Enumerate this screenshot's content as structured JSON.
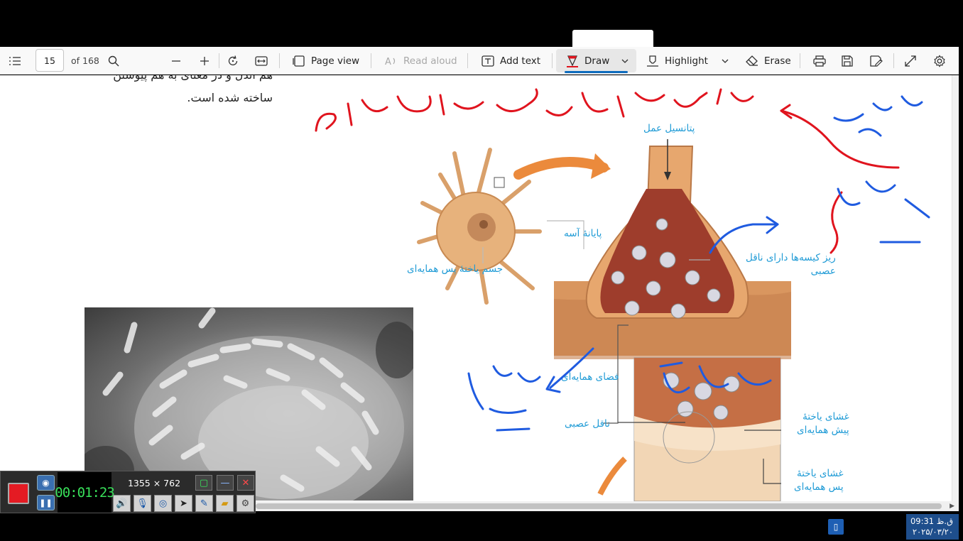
{
  "toolbar": {
    "page_current": "15",
    "page_total": "of 168",
    "page_view": "Page view",
    "read_aloud": "Read aloud",
    "add_text": "Add text",
    "draw": "Draw",
    "highlight": "Highlight",
    "erase": "Erase"
  },
  "document": {
    "text_line1": "هم اندل و در معنای به هم پیوستن",
    "text_line2": "ساخته شده است.",
    "labels": {
      "action_potential": "پتانسیل عمل",
      "terminal_bulb": "پایانهٔ آسه",
      "postsynaptic_body": "جسم یاختهٔ پس همایه‌ای",
      "vesicles_line1": "ریز کیسه‌ها دارای ناقل",
      "vesicles_line2": "عصبی",
      "synaptic_space": "فضای همایه‌ای",
      "neurotransmitter": "ناقل عصبی",
      "pre_membrane_line1": "غشای یاختهٔ",
      "pre_membrane_line2": "پیش همایه‌ای",
      "post_membrane_line1": "غشای یاختهٔ",
      "post_membrane_line2": "پس همایه‌ای"
    }
  },
  "recorder": {
    "timer": "00:01:23",
    "size": "1355 × 762"
  },
  "taskbar": {
    "time": "ق.ظ 09:31",
    "date": "۲۰۲۵/۰۳/۲۰"
  },
  "colors": {
    "ink_red": "#e0141e",
    "ink_blue": "#1f5be0",
    "label_blue": "#1f9bd6",
    "accent": "#0f6cbd"
  }
}
